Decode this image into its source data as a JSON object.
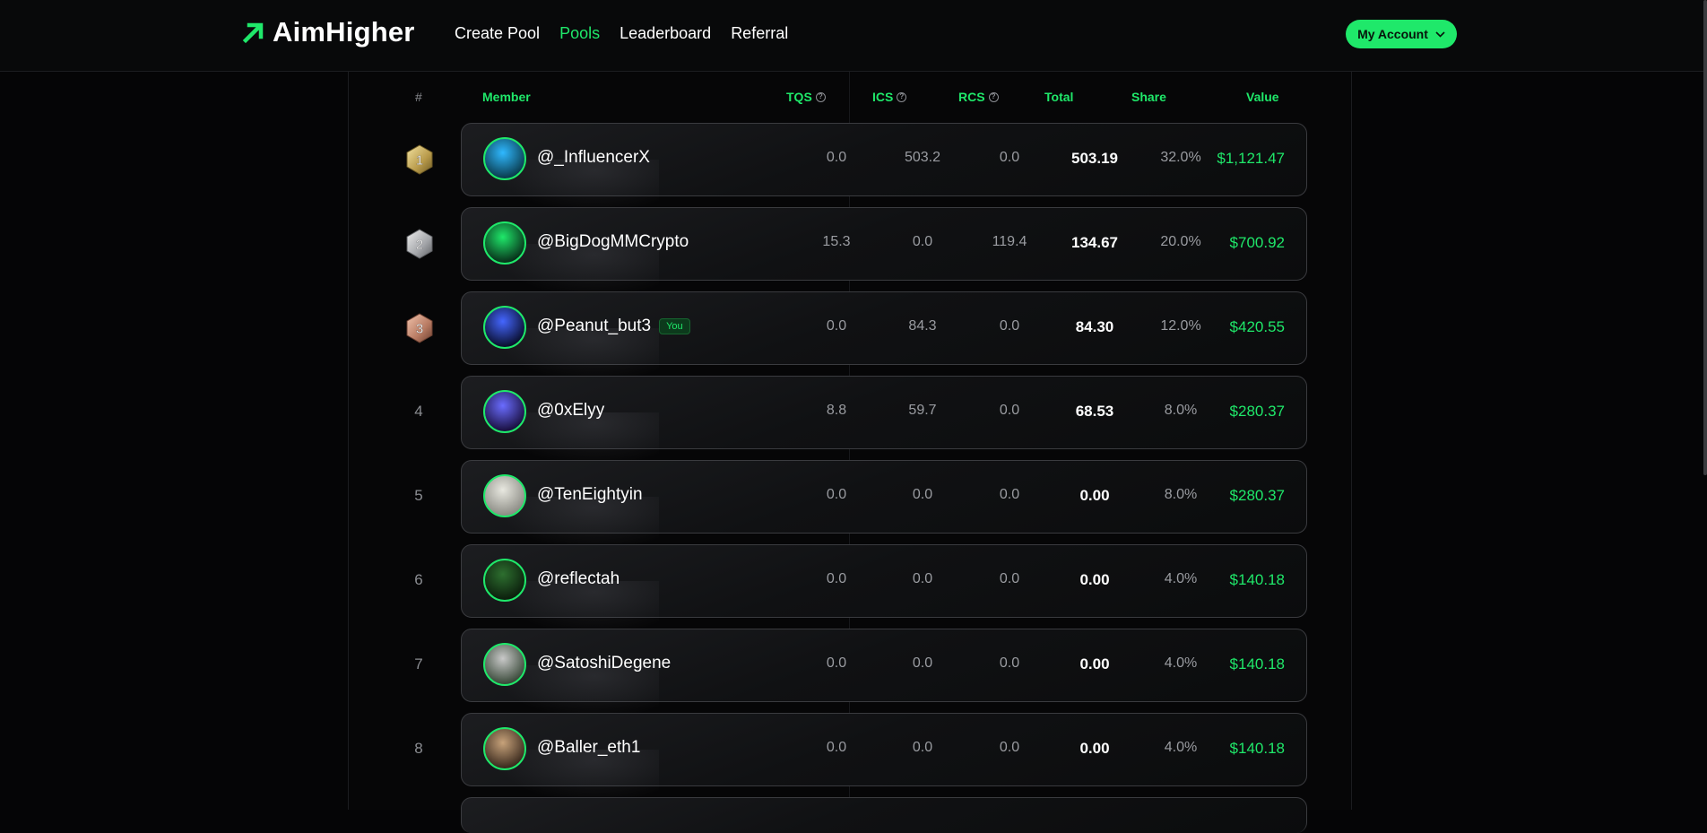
{
  "app": {
    "brand": "AimHigher",
    "accent_color": "#1fe86a"
  },
  "nav": {
    "items": [
      {
        "label": "Create Pool",
        "active": false
      },
      {
        "label": "Pools",
        "active": true
      },
      {
        "label": "Leaderboard",
        "active": false
      },
      {
        "label": "Referral",
        "active": false
      }
    ]
  },
  "account": {
    "label": "My Account",
    "icon": "chevron-down-icon"
  },
  "table": {
    "columns": {
      "rank": "#",
      "member": "Member",
      "tqs": "TQS",
      "ics": "ICS",
      "rcs": "RCS",
      "total": "Total",
      "share": "Share",
      "value": "Value"
    },
    "rows": [
      {
        "rank": "1",
        "medal": "gold",
        "name": "@_InfluencerX",
        "you": false,
        "tqs": "0.0",
        "ics": "503.2",
        "rcs": "0.0",
        "total": "503.19",
        "share": "32.0%",
        "value": "$1,121.47"
      },
      {
        "rank": "2",
        "medal": "silver",
        "name": "@BigDogMMCrypto",
        "you": false,
        "tqs": "15.3",
        "ics": "0.0",
        "rcs": "119.4",
        "total": "134.67",
        "share": "20.0%",
        "value": "$700.92"
      },
      {
        "rank": "3",
        "medal": "bronze",
        "name": "@Peanut_but3",
        "you": true,
        "you_label": "You",
        "tqs": "0.0",
        "ics": "84.3",
        "rcs": "0.0",
        "total": "84.30",
        "share": "12.0%",
        "value": "$420.55"
      },
      {
        "rank": "4",
        "medal": "",
        "name": "@0xElyy",
        "you": false,
        "tqs": "8.8",
        "ics": "59.7",
        "rcs": "0.0",
        "total": "68.53",
        "share": "8.0%",
        "value": "$280.37"
      },
      {
        "rank": "5",
        "medal": "",
        "name": "@TenEightyin",
        "you": false,
        "tqs": "0.0",
        "ics": "0.0",
        "rcs": "0.0",
        "total": "0.00",
        "share": "8.0%",
        "value": "$280.37"
      },
      {
        "rank": "6",
        "medal": "",
        "name": "@reflectah",
        "you": false,
        "tqs": "0.0",
        "ics": "0.0",
        "rcs": "0.0",
        "total": "0.00",
        "share": "4.0%",
        "value": "$140.18"
      },
      {
        "rank": "7",
        "medal": "",
        "name": "@SatoshiDegene",
        "you": false,
        "tqs": "0.0",
        "ics": "0.0",
        "rcs": "0.0",
        "total": "0.00",
        "share": "4.0%",
        "value": "$140.18"
      },
      {
        "rank": "8",
        "medal": "",
        "name": "@Baller_eth1",
        "you": false,
        "tqs": "0.0",
        "ics": "0.0",
        "rcs": "0.0",
        "total": "0.00",
        "share": "4.0%",
        "value": "$140.18"
      }
    ]
  }
}
